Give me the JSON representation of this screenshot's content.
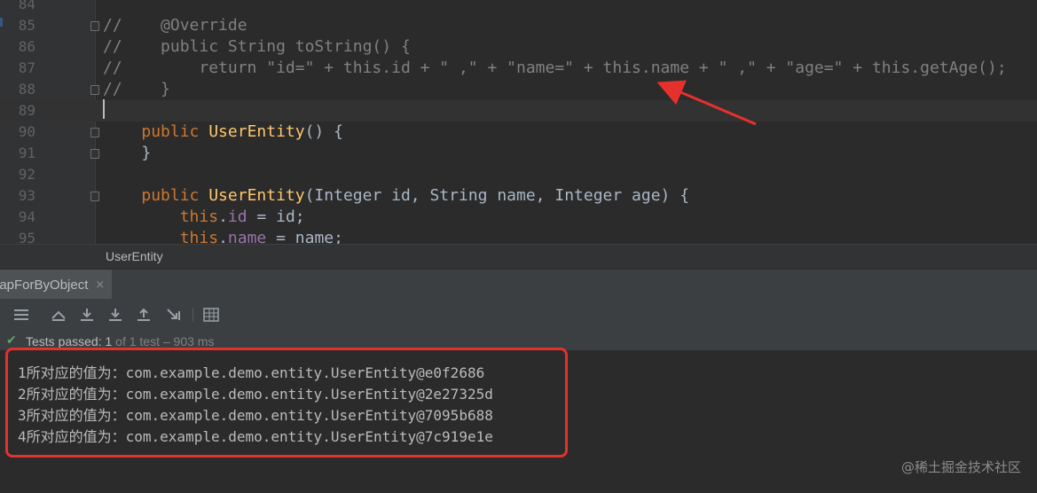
{
  "editor": {
    "lines": [
      {
        "num": "84",
        "tokens": []
      },
      {
        "num": "85",
        "tokens": [
          {
            "t": "//    @Override",
            "c": "c-comment"
          }
        ]
      },
      {
        "num": "86",
        "tokens": [
          {
            "t": "//    public String toString() {",
            "c": "c-comment"
          }
        ]
      },
      {
        "num": "87",
        "tokens": [
          {
            "t": "//        return \"id=\" + this.id + \" ,\" + \"name=\" + this.name + \" ,\" + \"age=\" + this.getAge();",
            "c": "c-comment"
          }
        ]
      },
      {
        "num": "88",
        "tokens": [
          {
            "t": "//    }",
            "c": "c-comment"
          }
        ]
      },
      {
        "num": "89",
        "tokens": [],
        "current": true
      },
      {
        "num": "90",
        "tokens": [
          {
            "t": "    "
          },
          {
            "t": "public ",
            "c": "c-kw"
          },
          {
            "t": "UserEntity",
            "c": "c-fn"
          },
          {
            "t": "() {"
          }
        ]
      },
      {
        "num": "91",
        "tokens": [
          {
            "t": "    }"
          }
        ]
      },
      {
        "num": "92",
        "tokens": []
      },
      {
        "num": "93",
        "tokens": [
          {
            "t": "    "
          },
          {
            "t": "public ",
            "c": "c-kw"
          },
          {
            "t": "UserEntity",
            "c": "c-fn"
          },
          {
            "t": "(Integer id, String name, Integer age) {"
          }
        ]
      },
      {
        "num": "94",
        "tokens": [
          {
            "t": "        "
          },
          {
            "t": "this",
            "c": "c-kw"
          },
          {
            "t": "."
          },
          {
            "t": "id",
            "c": "c-field"
          },
          {
            "t": " = id;"
          }
        ]
      },
      {
        "num": "95",
        "tokens": [
          {
            "t": "        "
          },
          {
            "t": "this",
            "c": "c-kw"
          },
          {
            "t": "."
          },
          {
            "t": "name",
            "c": "c-field"
          },
          {
            "t": " = name;"
          }
        ]
      }
    ]
  },
  "breadcrumb": {
    "label": "UserEntity"
  },
  "run_tab": {
    "label": "lapForByObject",
    "close": "×"
  },
  "toolbar": {
    "icons": [
      "list-icon",
      "rerun-icon",
      "import-icon",
      "export-down-icon",
      "export-up-icon",
      "sort-icon",
      "table-icon"
    ]
  },
  "status": {
    "check": "✔",
    "text": "Tests passed: 1",
    "meta": " of 1 test – 903 ms"
  },
  "console": {
    "lines": [
      "1所对应的值为：com.example.demo.entity.UserEntity@e0f2686",
      "2所对应的值为：com.example.demo.entity.UserEntity@2e27325d",
      "3所对应的值为：com.example.demo.entity.UserEntity@7095b688",
      "4所对应的值为：com.example.demo.entity.UserEntity@7c919e1e"
    ]
  },
  "watermark": "@稀土掘金技术社区",
  "colors": {
    "annotation_red": "#e5312b",
    "editor_bg": "#2b2b2b"
  }
}
